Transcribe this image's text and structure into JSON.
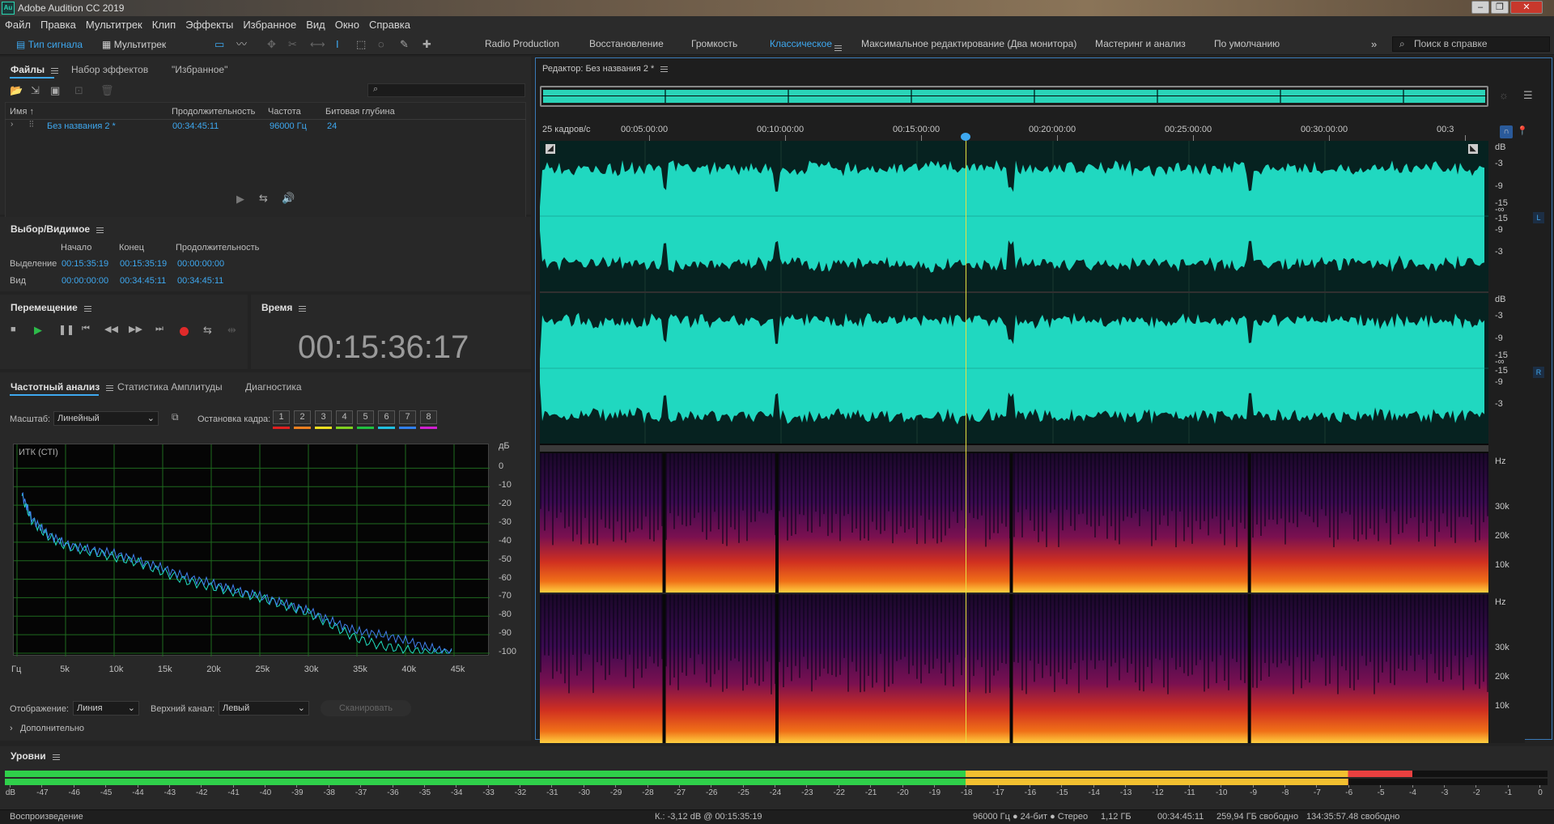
{
  "app": {
    "title": "Adobe Audition CC 2019",
    "logo": "Au"
  },
  "menu": [
    "Файл",
    "Правка",
    "Мультитрек",
    "Клип",
    "Эффекты",
    "Избранное",
    "Вид",
    "Окно",
    "Справка"
  ],
  "toolbar": {
    "waveform_mode": "Тип сигнала",
    "multitrack_mode": "Мультитрек",
    "workspaces": [
      "Radio Production",
      "Восстановление",
      "Громкость",
      "Классическое",
      "Максимальное редактирование (Два монитора)",
      "Мастеринг и анализ",
      "По умолчанию"
    ],
    "active_workspace": "Классическое",
    "search_placeholder": "Поиск в справке"
  },
  "files_panel": {
    "tabs": [
      "Файлы",
      "Набор эффектов",
      "\"Избранное\""
    ],
    "columns": [
      "Имя",
      "Продолжительность",
      "Частота",
      "Битовая глубина"
    ],
    "rows": [
      {
        "name": "Без названия 2 *",
        "duration": "00:34:45:11",
        "rate": "96000 Гц",
        "depth": "24"
      }
    ]
  },
  "selection_panel": {
    "title": "Выбор/Видимое",
    "headers": [
      "Начало",
      "Конец",
      "Продолжительность"
    ],
    "selection": {
      "label": "Выделение",
      "start": "00:15:35:19",
      "end": "00:15:35:19",
      "duration": "00:00:00:00"
    },
    "view": {
      "label": "Вид",
      "start": "00:00:00:00",
      "end": "00:34:45:11",
      "duration": "00:34:45:11"
    }
  },
  "transport_panel": {
    "title": "Перемещение"
  },
  "time_panel": {
    "title": "Время",
    "time": "00:15:36:17"
  },
  "analysis_panel": {
    "tabs": [
      "Частотный анализ",
      "Статистика Амплитуды",
      "Диагностика"
    ],
    "scale_label": "Масштаб:",
    "scale_value": "Линейный",
    "freeze_label": "Остановка кадра:",
    "freeze_buttons": [
      "1",
      "2",
      "3",
      "4",
      "5",
      "6",
      "7",
      "8"
    ],
    "freeze_colors": [
      "#e02020",
      "#f08020",
      "#f0e020",
      "#80d020",
      "#20c040",
      "#20c0e0",
      "#3080f0",
      "#d020d0"
    ],
    "plot_label": "ИТК (СТI)",
    "display_label": "Отображение:",
    "display_value": "Линия",
    "channel_label": "Верхний канал:",
    "channel_value": "Левый",
    "scan_button": "Сканировать",
    "advanced": "Дополнительно"
  },
  "chart_data": {
    "type": "line",
    "title": "",
    "xlabel": "",
    "ylabel": "дБ",
    "x_ticks": [
      "Гц",
      "5k",
      "10k",
      "15k",
      "20k",
      "25k",
      "30k",
      "35k",
      "40k",
      "45k"
    ],
    "y_ticks": [
      "0",
      "-10",
      "-20",
      "-30",
      "-40",
      "-50",
      "-60",
      "-70",
      "-80",
      "-90",
      "-100"
    ],
    "xlim": [
      0,
      48000
    ],
    "ylim": [
      -100,
      5
    ],
    "grid": true,
    "series": [
      {
        "color": "#20e0c0",
        "x": [
          500,
          1500,
          3000,
          5000,
          7500,
          10000,
          12500,
          15000,
          17500,
          20000,
          22500,
          25000,
          27500,
          30000,
          32500,
          35000,
          37500,
          40000,
          42500,
          45000
        ],
        "y": [
          -15,
          -28,
          -36,
          -42,
          -45,
          -48,
          -51,
          -56,
          -61,
          -64,
          -67,
          -70,
          -74,
          -78,
          -85,
          -92,
          -96,
          -98,
          -100,
          -100
        ]
      },
      {
        "color": "#4080f0",
        "x": [
          500,
          1500,
          3000,
          5000,
          7500,
          10000,
          12500,
          15000,
          17500,
          20000,
          22500,
          25000,
          27500,
          30000,
          32500,
          35000,
          37500,
          40000,
          42500,
          45000
        ],
        "y": [
          -14,
          -27,
          -35,
          -41,
          -44,
          -46,
          -50,
          -54,
          -59,
          -62,
          -66,
          -69,
          -73,
          -77,
          -83,
          -88,
          -90,
          -93,
          -97,
          -100
        ]
      }
    ]
  },
  "editor": {
    "title": "Редактор: Без названия 2 *",
    "timeline_label": "25 кадров/с",
    "timeline_ticks": [
      "00:05:00:00",
      "00:10:00:00",
      "00:15:00:00",
      "00:20:00:00",
      "00:25:00:00",
      "00:30:00:00",
      "00:3"
    ],
    "db_ticks": [
      "dB",
      "-3",
      "-9",
      "-15",
      "-∞",
      "-15",
      "-9",
      "-3"
    ],
    "channels": [
      "L",
      "R"
    ],
    "hz_label": "Hz",
    "hz_ticks": [
      "30k",
      "20k",
      "10k"
    ],
    "playhead_fraction": 0.449
  },
  "levels": {
    "title": "Уровни",
    "scale": [
      "dB",
      "-47",
      "-46",
      "-45",
      "-44",
      "-43",
      "-42",
      "-41",
      "-40",
      "-39",
      "-38",
      "-37",
      "-36",
      "-35",
      "-34",
      "-33",
      "-32",
      "-31",
      "-30",
      "-29",
      "-28",
      "-27",
      "-26",
      "-25",
      "-24",
      "-23",
      "-22",
      "-21",
      "-20",
      "-19",
      "-18",
      "-17",
      "-16",
      "-15",
      "-14",
      "-13",
      "-12",
      "-11",
      "-10",
      "-9",
      "-8",
      "-7",
      "-6",
      "-5",
      "-4",
      "-3",
      "-2",
      "-1",
      "0"
    ],
    "left_level_db": -4,
    "right_level_db": -6
  },
  "status": {
    "mode": "Воспроизведение",
    "cursor": "К.: -3,12 dB @ 00:15:35:19",
    "format": "96000 Гц ● 24-бит ● Стерео",
    "size": "1,12 ГБ",
    "duration": "00:34:45:11",
    "free1": "259,94 ГБ свободно",
    "free2": "134:35:57.48 свободно"
  }
}
